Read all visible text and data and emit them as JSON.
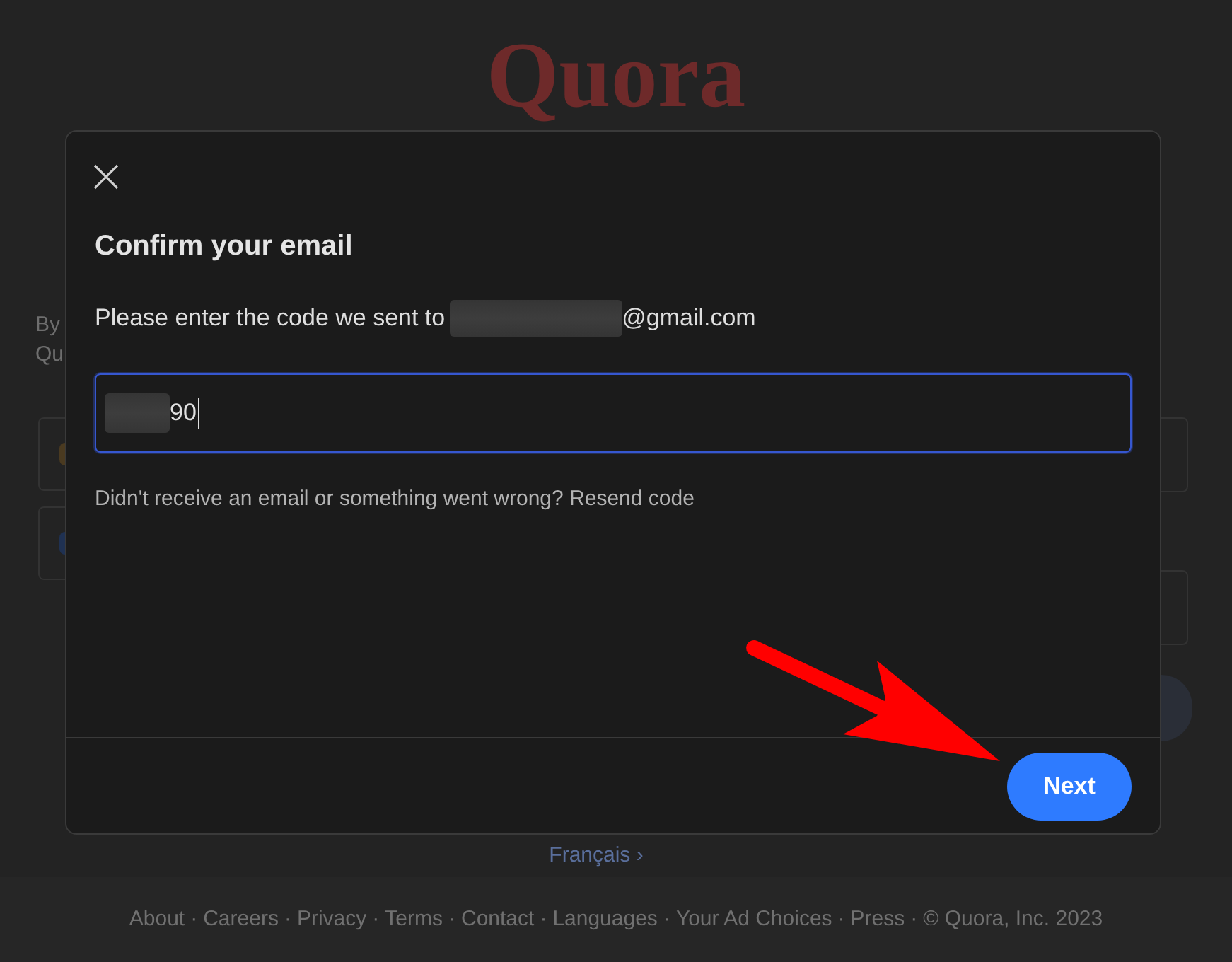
{
  "background": {
    "logo": "Quora",
    "left_column": {
      "text_lines": [
        "By",
        "Qu"
      ],
      "buttons": [
        {
          "color": "#4a3a20"
        },
        {
          "color": "#1f3152"
        }
      ]
    },
    "right_column": {
      "items": [
        {
          "kind": "field"
        },
        {
          "kind": "field"
        },
        {
          "kind": "round_button"
        }
      ]
    },
    "language_link": "Français ›",
    "footer": {
      "separator": "·",
      "links": [
        "About",
        "Careers",
        "Privacy",
        "Terms",
        "Contact",
        "Languages",
        "Your Ad Choices",
        "Press"
      ],
      "copyright": "© Quora, Inc. 2023"
    }
  },
  "modal": {
    "title": "Confirm your email",
    "instruction": {
      "text": "Please enter the code we sent to",
      "recipient_redacted": true,
      "domain": "@gmail.com"
    },
    "code_field": {
      "value": "90",
      "redacted_prefix": true,
      "focused": true,
      "cursor": true
    },
    "help": {
      "text": "Didn't receive an email or something went wrong?",
      "link": "Resend code"
    },
    "primary_button": {
      "label": "Next"
    }
  },
  "annotations": [
    {
      "kind": "arrow"
    }
  ]
}
